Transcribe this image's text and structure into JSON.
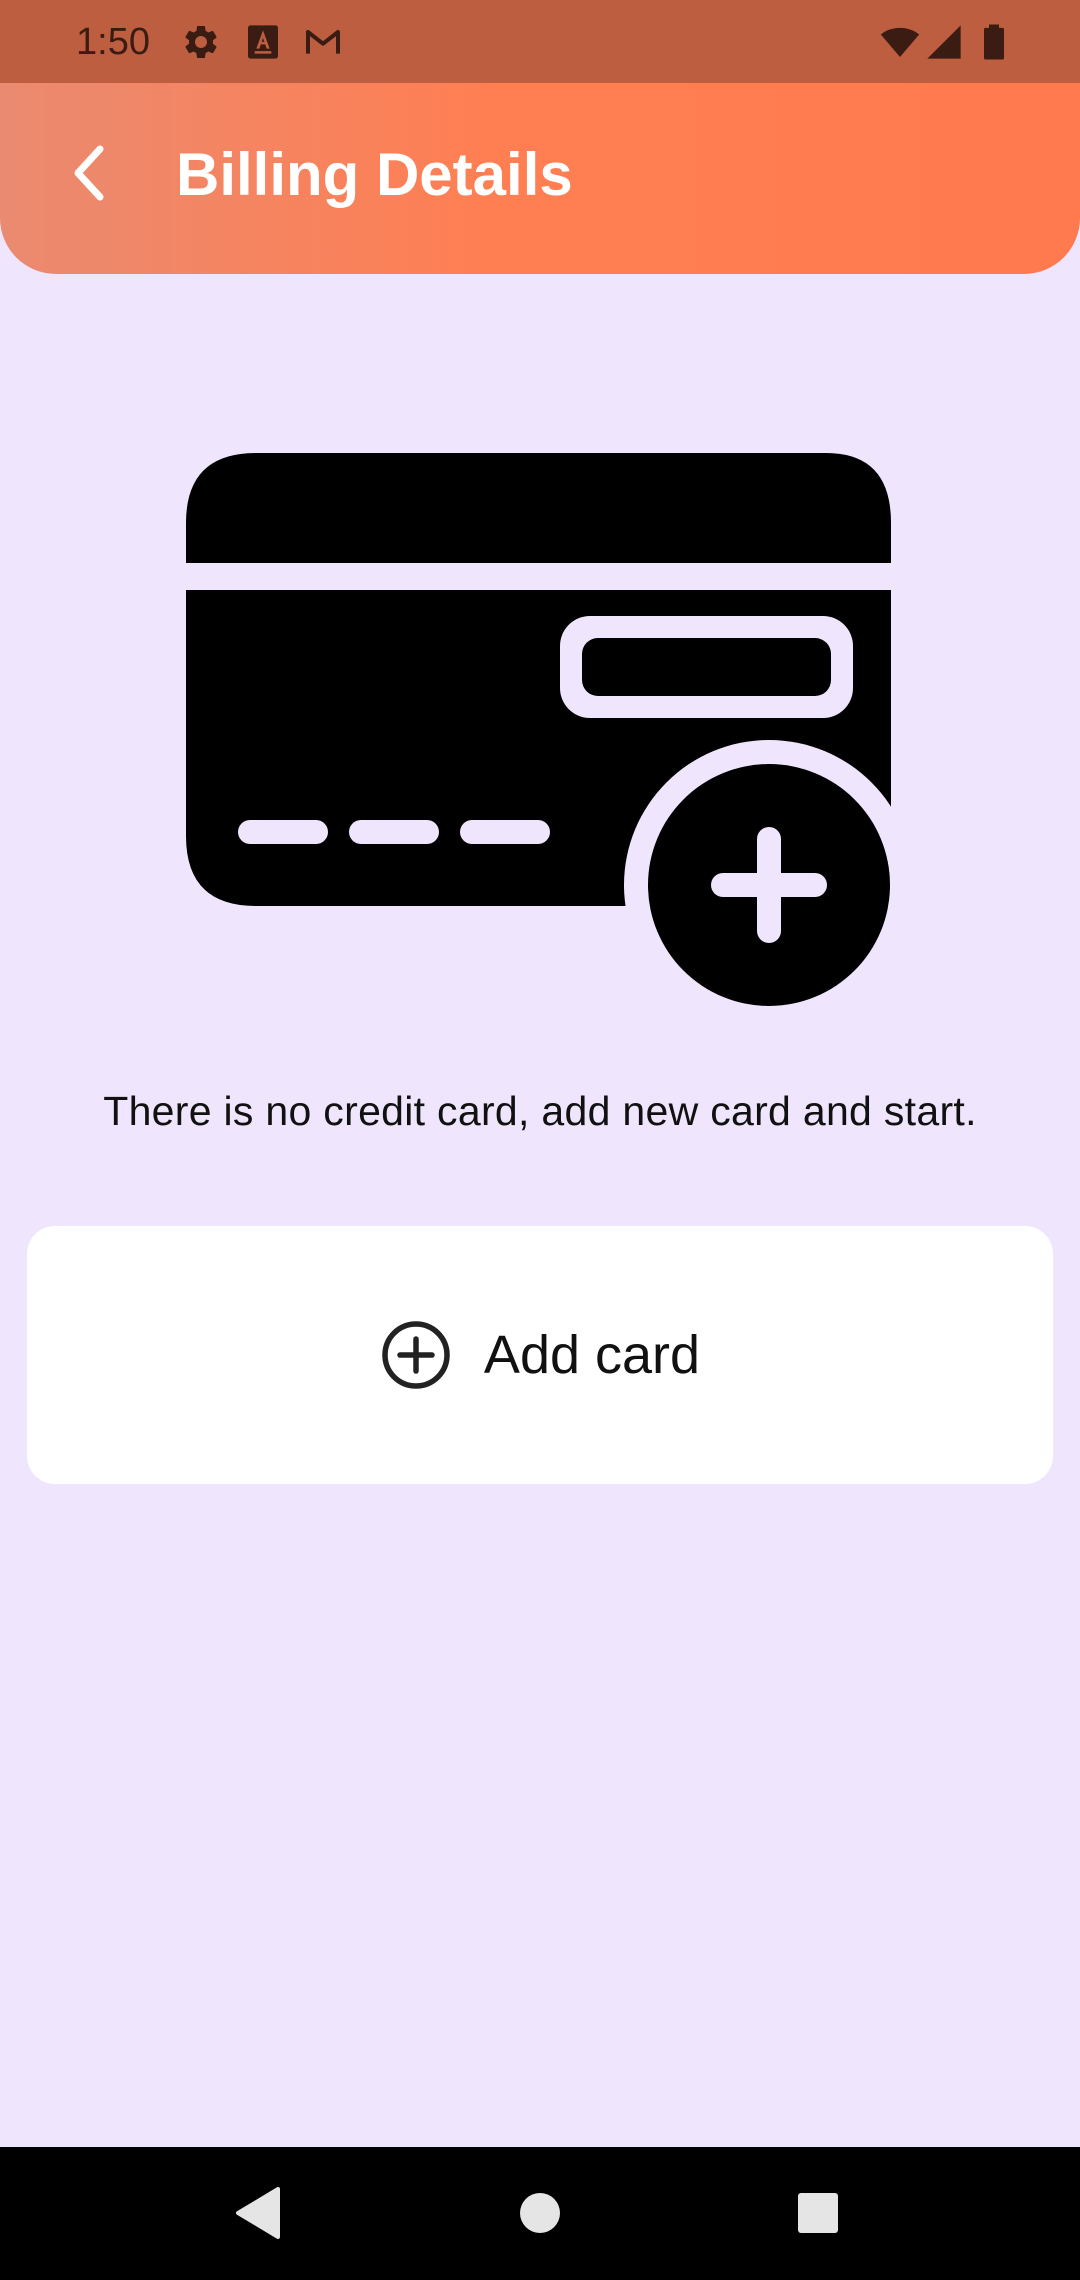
{
  "status_bar": {
    "time": "1:50",
    "left_icons": [
      "gear-icon",
      "keyboard-a-icon",
      "gmail-icon"
    ],
    "right_icons": [
      "wifi-icon",
      "signal-icon",
      "battery-icon"
    ]
  },
  "app_bar": {
    "title": "Billing Details",
    "back_icon": "chevron-left-icon"
  },
  "empty_state": {
    "illustration": "credit-card-add-icon",
    "message": "There is no credit card, add new card and start."
  },
  "add_card_button": {
    "icon": "add-circle-outline-icon",
    "label": "Add card"
  },
  "nav_bar": {
    "items": [
      "back-triangle-icon",
      "home-circle-icon",
      "recents-square-icon"
    ]
  },
  "colors": {
    "background": "#EFE5FD",
    "status_bar": "#BD5E40",
    "app_bar_start": "#EA8A70",
    "app_bar_end": "#FF7A4E",
    "button_background": "#FFFFFF",
    "text_primary": "#111111"
  }
}
